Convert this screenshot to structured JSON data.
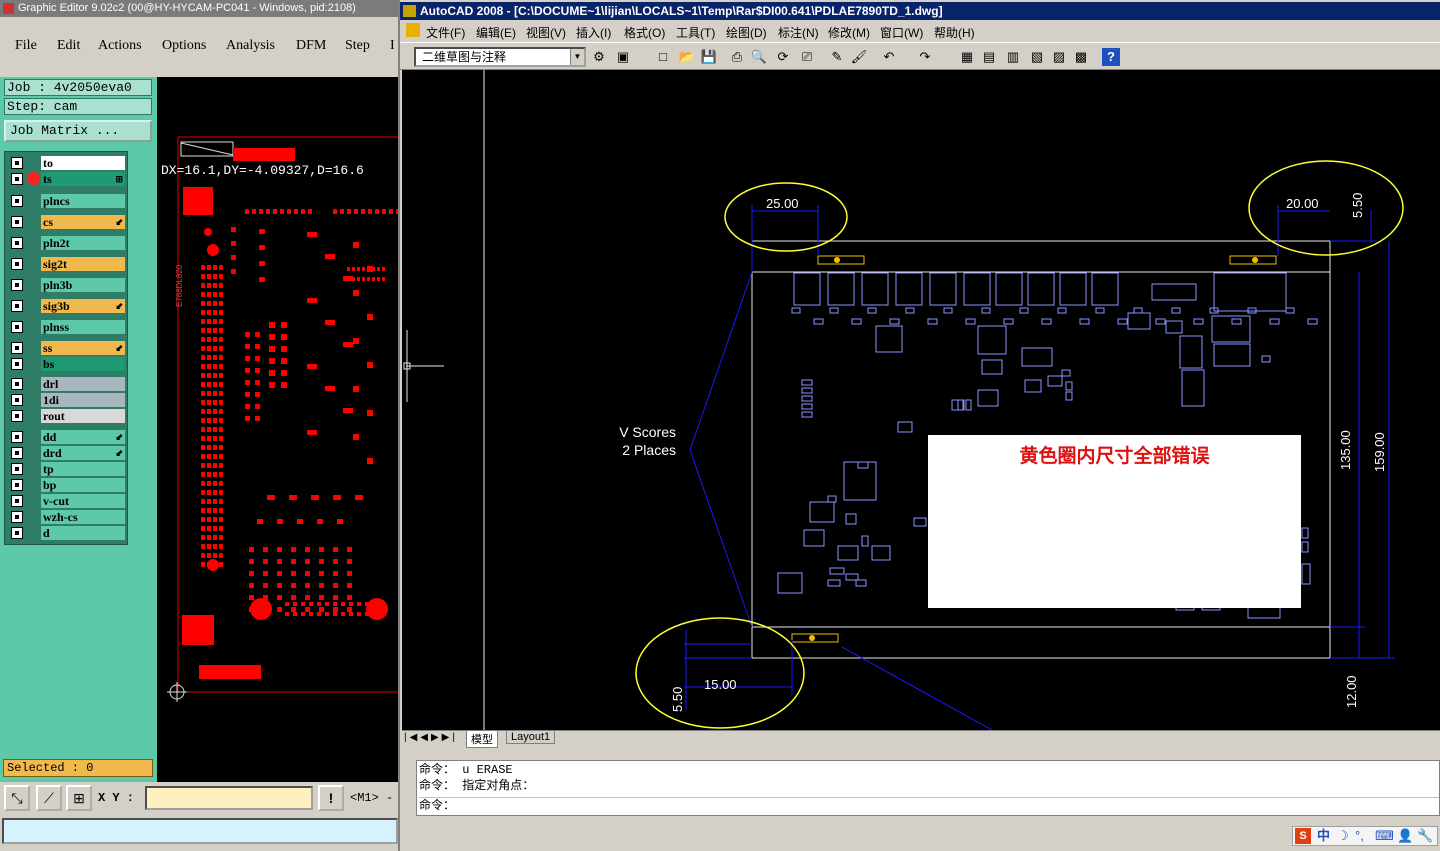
{
  "left_window": {
    "title": "Graphic Editor 9.02c2 (00@HY-HYCAM-PC041 - Windows, pid:2108)",
    "menu": [
      "File",
      "Edit",
      "Actions",
      "Options",
      "Analysis",
      "DFM",
      "Step",
      "I"
    ],
    "job_line": "Job : 4v2050eva0",
    "step_line": "Step: cam",
    "job_matrix_label": "Job Matrix ...",
    "layers": [
      {
        "name": "to",
        "color": "#ffffff",
        "flag": ""
      },
      {
        "name": "ts",
        "color": "#1f9a72",
        "flag": "⊞"
      },
      {
        "name": "plncs",
        "color": "#5ec9a8",
        "flag": ""
      },
      {
        "name": "cs",
        "color": "#f0b94e",
        "flag": "⬋"
      },
      {
        "name": "pln2t",
        "color": "#5ec9a8",
        "flag": ""
      },
      {
        "name": "sig2t",
        "color": "#f0b94e",
        "flag": ""
      },
      {
        "name": "pln3b",
        "color": "#5ec9a8",
        "flag": ""
      },
      {
        "name": "sig3b",
        "color": "#f0b94e",
        "flag": "⬋"
      },
      {
        "name": "plnss",
        "color": "#5ec9a8",
        "flag": ""
      },
      {
        "name": "ss",
        "color": "#f0b94e",
        "flag": "⬋"
      },
      {
        "name": "bs",
        "color": "#1f9a72",
        "flag": ""
      },
      {
        "name": "drl",
        "color": "#a8b6c0",
        "flag": ""
      },
      {
        "name": "1di",
        "color": "#a8b6c0",
        "flag": ""
      },
      {
        "name": "rout",
        "color": "#d8d8d8",
        "flag": ""
      },
      {
        "name": "dd",
        "color": "#5ec9a8",
        "flag": "⬋"
      },
      {
        "name": "drd",
        "color": "#5ec9a8",
        "flag": "⬋"
      },
      {
        "name": "tp",
        "color": "#5ec9a8",
        "flag": ""
      },
      {
        "name": "bp",
        "color": "#5ec9a8",
        "flag": ""
      },
      {
        "name": "v-cut",
        "color": "#5ec9a8",
        "flag": ""
      },
      {
        "name": "wzh-cs",
        "color": "#5ec9a8",
        "flag": ""
      },
      {
        "name": "d",
        "color": "#5ec9a8",
        "flag": ""
      }
    ],
    "measure_text": "DX=16.1,DY=-4.09327,D=16.6",
    "board_label": "E788DL820",
    "selected_text": "Selected : 0",
    "xy_label": "X Y :",
    "mouse_mode": "<M1> -",
    "xy_value": ""
  },
  "right_window": {
    "title": "AutoCAD 2008 - [C:\\DOCUME~1\\lijian\\LOCALS~1\\Temp\\Rar$DI00.641\\PDLAE7890TD_1.dwg]",
    "menu": [
      "文件(F)",
      "编辑(E)",
      "视图(V)",
      "插入(I)",
      "格式(O)",
      "工具(T)",
      "绘图(D)",
      "标注(N)",
      "修改(M)",
      "窗口(W)",
      "帮助(H)"
    ],
    "workspace": "二维草图与注释",
    "dimensions": {
      "d1": "25.00",
      "d2": "20.00",
      "d3": "5.50",
      "d4": "135.00",
      "d5": "159.00",
      "d6": "15.00",
      "d7": "5.50",
      "d8": "12.00"
    },
    "v_scores": [
      "V Scores",
      "2 Places"
    ],
    "note": "黄色圈内尺寸全部错误",
    "tabs": [
      "模型",
      "Layout1"
    ],
    "command_lines": [
      "命令：  u ERASE",
      "命令： 指定对角点：",
      "命令："
    ],
    "ime": "中"
  },
  "colors": {
    "pcb_red": "#ff0000",
    "cad_blue": "#1a1aff",
    "cad_outline": "#e8e8e8",
    "highlight_yellow": "#ffff33",
    "note_red": "#e01010",
    "panel_green": "#5ec9a8"
  }
}
